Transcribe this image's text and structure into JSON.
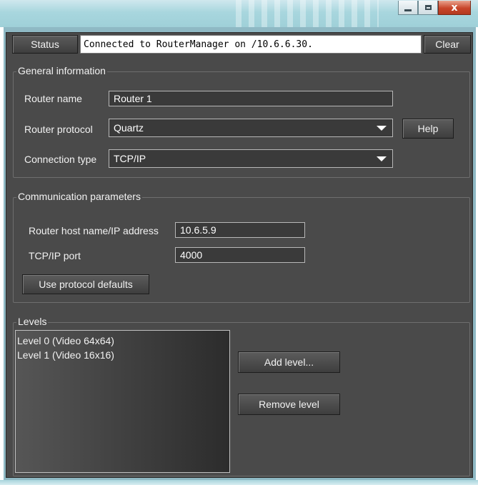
{
  "window": {
    "minimize_icon": "minimize-icon",
    "maximize_icon": "maximize-icon",
    "close_glyph": "x"
  },
  "status": {
    "button_label": "Status",
    "message": "Connected to RouterManager on /10.6.6.30.",
    "clear_label": "Clear"
  },
  "general": {
    "title": "General information",
    "router_name_label": "Router name",
    "router_name_value": "Router 1",
    "router_protocol_label": "Router protocol",
    "router_protocol_value": "Quartz",
    "help_label": "Help",
    "connection_type_label": "Connection type",
    "connection_type_value": "TCP/IP"
  },
  "communication": {
    "title": "Communication parameters",
    "host_label": "Router host name/IP address",
    "host_value": "10.6.5.9",
    "port_label": "TCP/IP port",
    "port_value": "4000",
    "defaults_label": "Use protocol defaults"
  },
  "levels": {
    "title": "Levels",
    "items": [
      {
        "label": "Level 0 (Video 64x64)"
      },
      {
        "label": "Level 1 (Video 16x16)"
      }
    ],
    "add_label": "Add level...",
    "remove_label": "Remove level"
  },
  "colors": {
    "panel_bg": "#4a4a4a",
    "titlebar": "#a8d6de",
    "close_button": "#c8452a"
  }
}
